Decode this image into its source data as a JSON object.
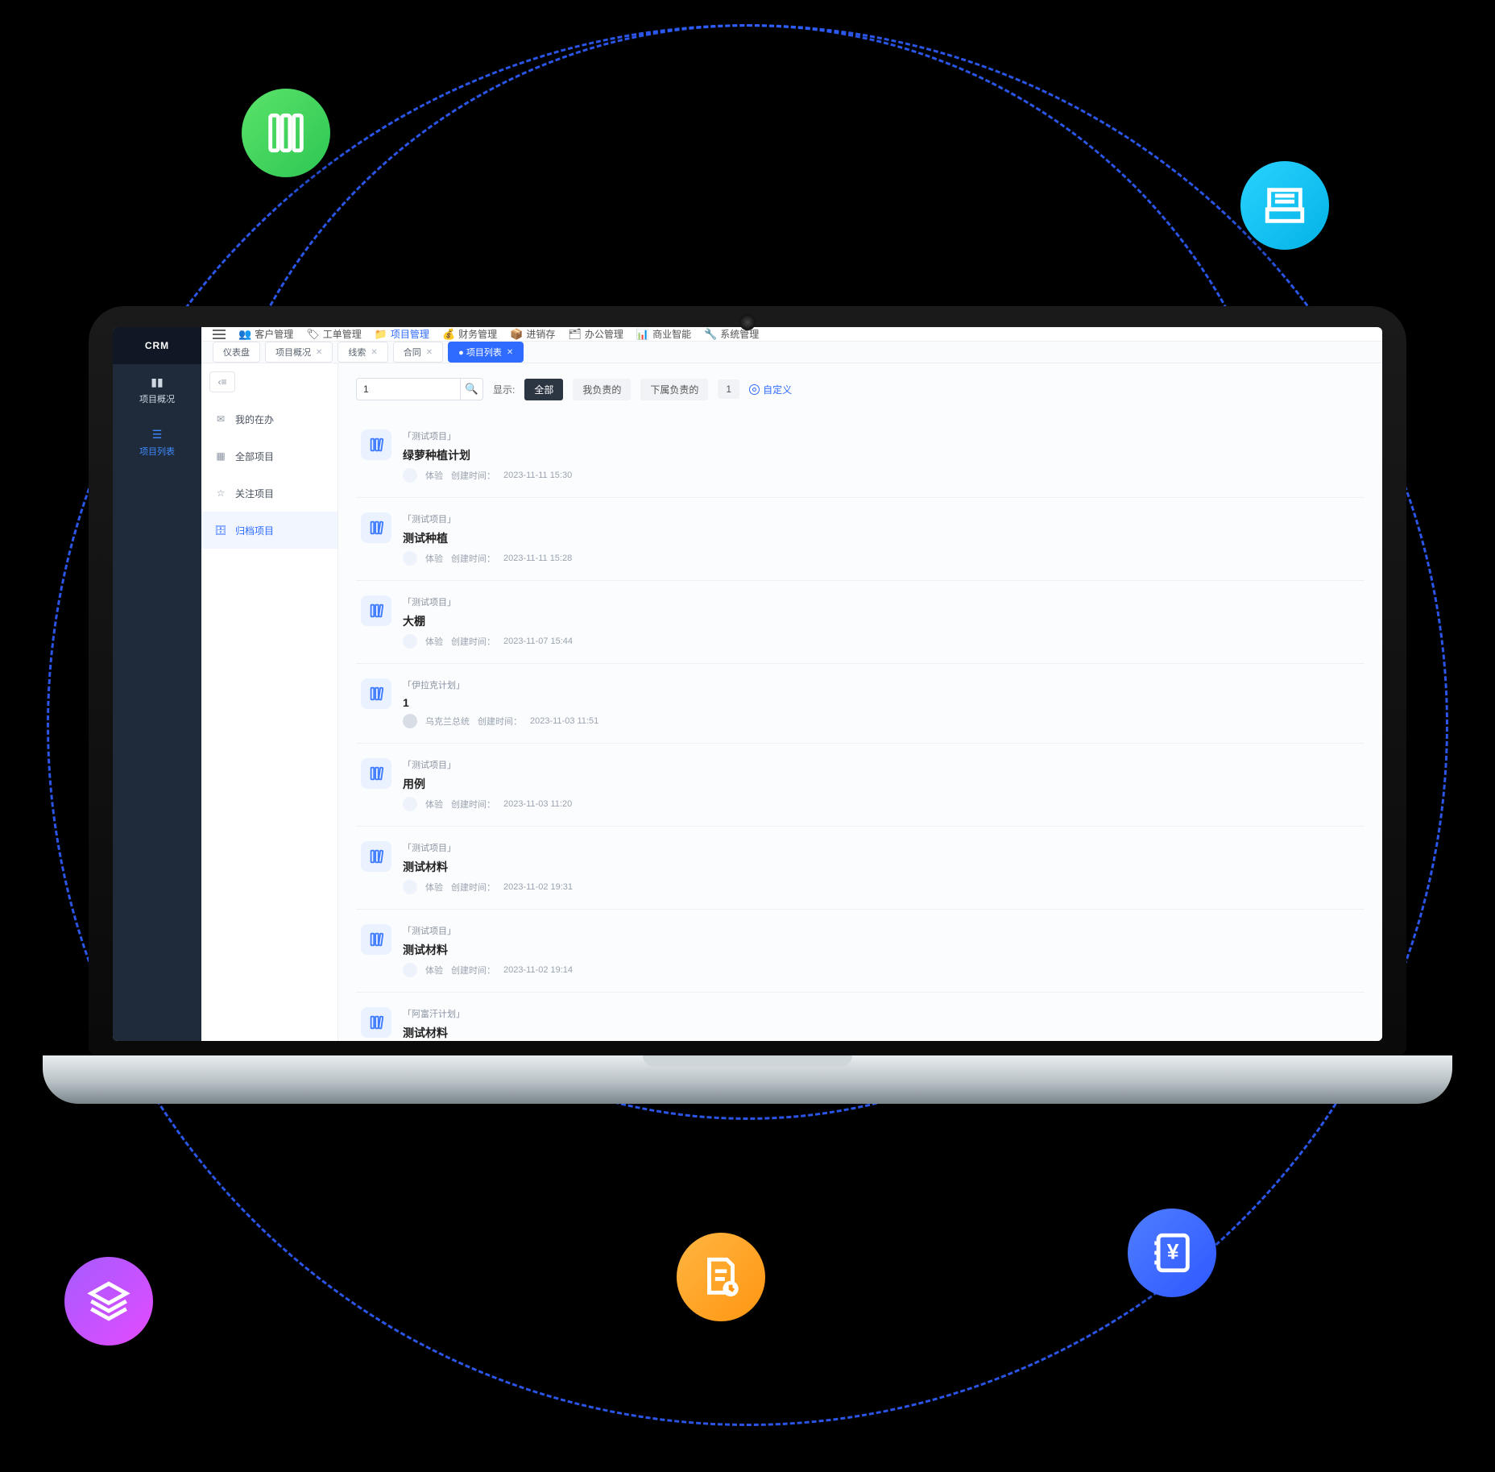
{
  "brand": "CRM",
  "rail": {
    "items": [
      {
        "icon": "chart",
        "label": "项目概况"
      },
      {
        "icon": "list",
        "label": "项目列表"
      }
    ],
    "active": 1
  },
  "topnav": {
    "items": [
      {
        "icon": "users",
        "label": "客户管理"
      },
      {
        "icon": "ticket",
        "label": "工单管理"
      },
      {
        "icon": "project",
        "label": "项目管理"
      },
      {
        "icon": "money",
        "label": "财务管理"
      },
      {
        "icon": "box",
        "label": "进销存"
      },
      {
        "icon": "office",
        "label": "办公管理"
      },
      {
        "icon": "bi",
        "label": "商业智能"
      },
      {
        "icon": "wrench",
        "label": "系统管理"
      }
    ],
    "active": 2
  },
  "tabs": {
    "items": [
      "仪表盘",
      "项目概况",
      "线索",
      "合同",
      "● 项目列表"
    ],
    "active": 4
  },
  "sidebar": {
    "items": [
      {
        "icon": "inbox",
        "label": "我的在办"
      },
      {
        "icon": "grid",
        "label": "全部项目"
      },
      {
        "icon": "star",
        "label": "关注项目"
      },
      {
        "icon": "archive",
        "label": "归档项目"
      }
    ],
    "active": 3
  },
  "filters": {
    "search_value": "1",
    "show_label": "显示:",
    "chips": [
      "全部",
      "我负责的",
      "下属负责的",
      "1"
    ],
    "custom": "自定义"
  },
  "projects": [
    {
      "tag": "「测试项目」",
      "name": "绿萝种植计划",
      "owner": "体验",
      "owner_kind": "light",
      "created_label": "创建时间：",
      "created": "2023-11-11 15:30"
    },
    {
      "tag": "「测试项目」",
      "name": "测试种植",
      "owner": "体验",
      "owner_kind": "light",
      "created_label": "创建时间：",
      "created": "2023-11-11 15:28"
    },
    {
      "tag": "「测试项目」",
      "name": "大棚",
      "owner": "体验",
      "owner_kind": "light",
      "created_label": "创建时间：",
      "created": "2023-11-07 15:44"
    },
    {
      "tag": "「伊拉克计划」",
      "name": "1",
      "owner": "乌克兰总统",
      "owner_kind": "gray",
      "created_label": "创建时间：",
      "created": "2023-11-03 11:51"
    },
    {
      "tag": "「测试项目」",
      "name": "用例",
      "owner": "体验",
      "owner_kind": "light",
      "created_label": "创建时间：",
      "created": "2023-11-03 11:20"
    },
    {
      "tag": "「测试项目」",
      "name": "测试材料",
      "owner": "体验",
      "owner_kind": "light",
      "created_label": "创建时间：",
      "created": "2023-11-02 19:31"
    },
    {
      "tag": "「测试项目」",
      "name": "测试材料",
      "owner": "体验",
      "owner_kind": "light",
      "created_label": "创建时间：",
      "created": "2023-11-02 19:14"
    },
    {
      "tag": "「阿富汗计划」",
      "name": "测试材料",
      "owner": "",
      "owner_kind": "none",
      "created_label": "",
      "created": ""
    }
  ]
}
